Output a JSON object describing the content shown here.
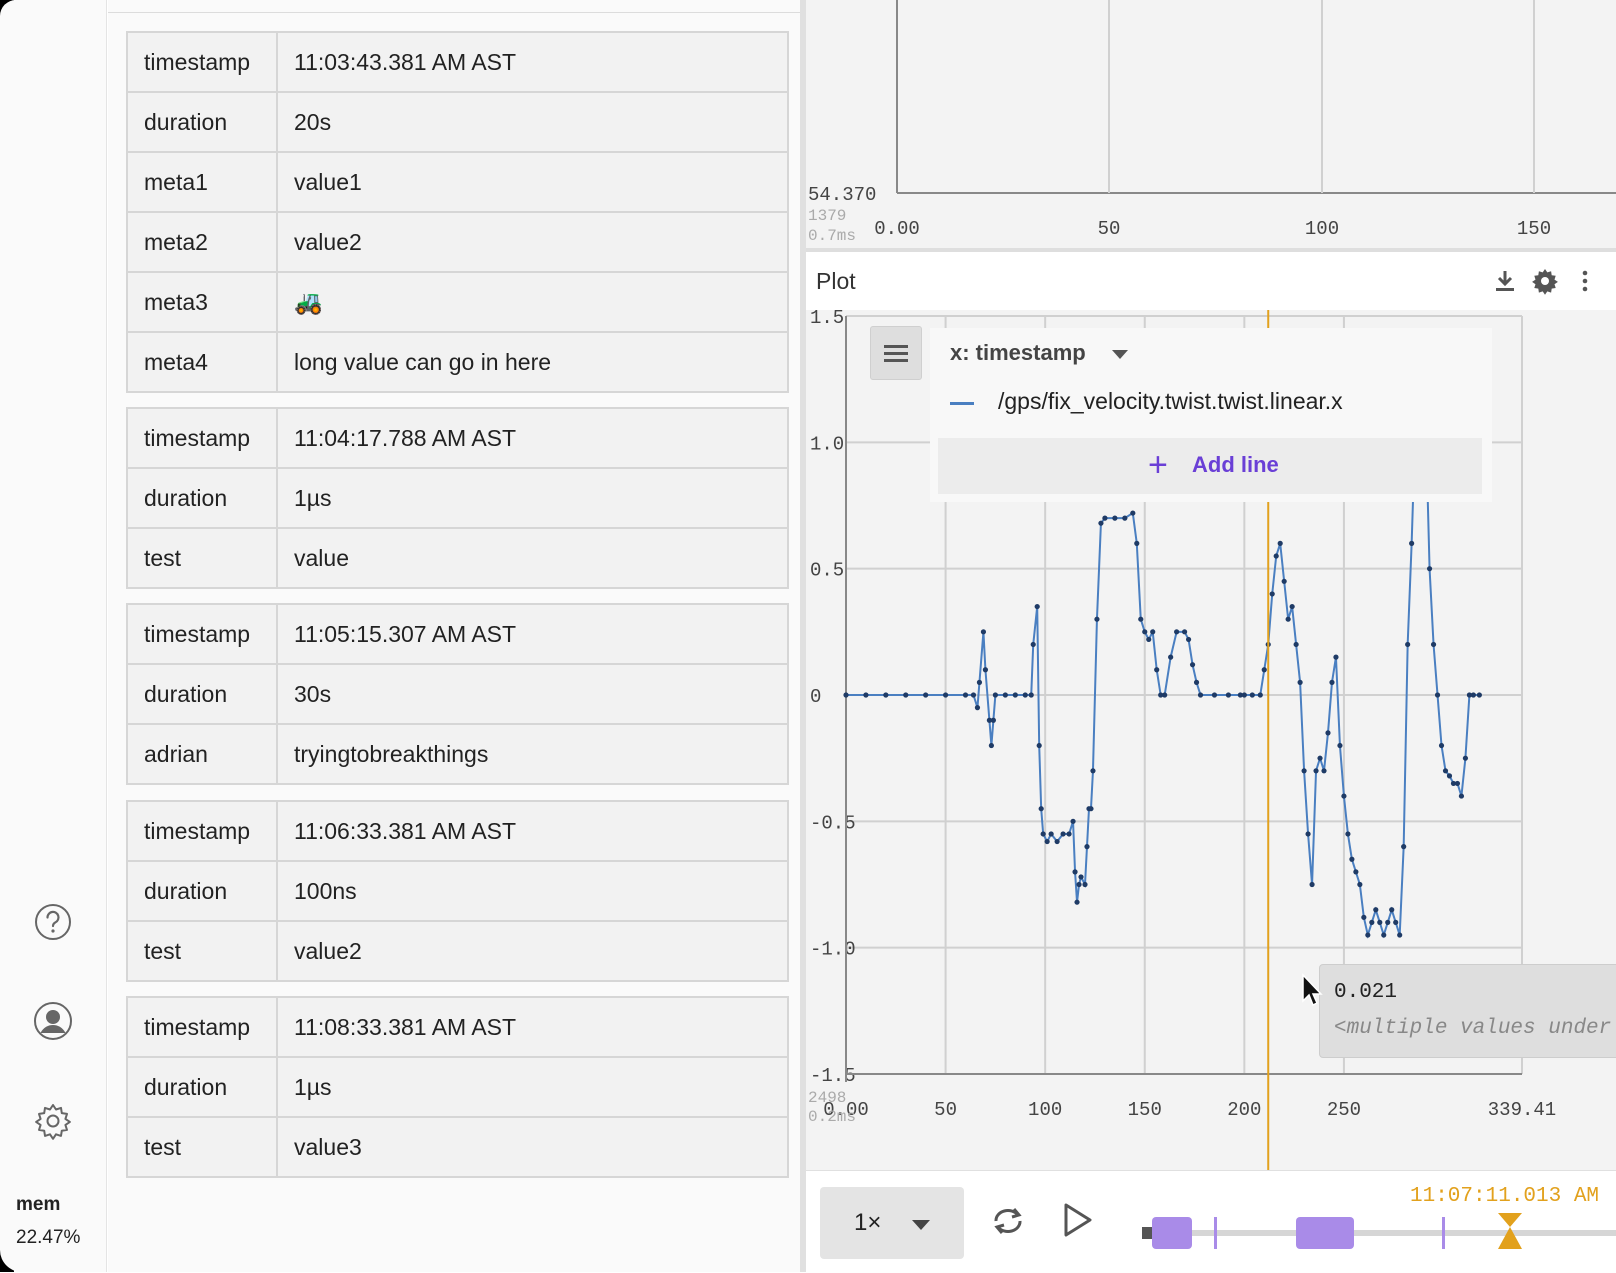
{
  "sidebar": {
    "items": [
      "help-icon",
      "user-icon",
      "gear-icon"
    ],
    "mem_label": "mem",
    "mem_value": "22.47%"
  },
  "metadata": [
    {
      "rows": [
        {
          "key": "timestamp",
          "value": "11:03:43.381 AM AST"
        },
        {
          "key": "duration",
          "value": "20s"
        },
        {
          "key": "meta1",
          "value": "value1"
        },
        {
          "key": "meta2",
          "value": "value2"
        },
        {
          "key": "meta3",
          "value": "🚜"
        },
        {
          "key": "meta4",
          "value": "long value can go in here"
        }
      ]
    },
    {
      "rows": [
        {
          "key": "timestamp",
          "value": "11:04:17.788 AM AST"
        },
        {
          "key": "duration",
          "value": "1µs"
        },
        {
          "key": "test",
          "value": "value"
        }
      ]
    },
    {
      "rows": [
        {
          "key": "timestamp",
          "value": "11:05:15.307 AM AST"
        },
        {
          "key": "duration",
          "value": "30s"
        },
        {
          "key": "adrian",
          "value": "tryingtobreakthings"
        }
      ]
    },
    {
      "rows": [
        {
          "key": "timestamp",
          "value": "11:06:33.381 AM AST"
        },
        {
          "key": "duration",
          "value": "100ns"
        },
        {
          "key": "test",
          "value": "value2"
        }
      ]
    },
    {
      "rows": [
        {
          "key": "timestamp",
          "value": "11:08:33.381 AM AST"
        },
        {
          "key": "duration",
          "value": "1µs"
        },
        {
          "key": "test",
          "value": "value3"
        }
      ]
    }
  ],
  "top_plot": {
    "y_label": "54.370",
    "stats_count": "1379",
    "stats_time": "0.7ms",
    "x_ticks": [
      "0.00",
      "50",
      "100",
      "150"
    ]
  },
  "plot_panel": {
    "title": "Plot",
    "header_icons": [
      "download-icon",
      "gear-icon",
      "more-vertical-icon"
    ],
    "x_selector": "x: timestamp",
    "series_path": "/gps/fix_velocity.twist.twist.linear.x",
    "add_line_label": "Add line",
    "stats_count": "2498",
    "stats_time": "0.2ms",
    "tooltip_value": "0.021",
    "tooltip_note": "<multiple values under cursor>"
  },
  "playback": {
    "speed": "1×",
    "time": "11:07:11.013 AM"
  },
  "colors": {
    "series": "#4a7fc1",
    "series_dark": "#1f3b66",
    "cursor": "#e2a11d",
    "accent": "#6a3fd6",
    "range": "#a98be8"
  },
  "chart_data": {
    "type": "line",
    "xlabel": "",
    "ylabel": "",
    "xlim": [
      0,
      339.41
    ],
    "ylim": [
      -1.5,
      1.5
    ],
    "x_tick_labels": [
      "0.00",
      "50",
      "100",
      "150",
      "200",
      "250",
      "339.41"
    ],
    "y_tick_labels": [
      "1.5",
      "1.0",
      "0.5",
      "0",
      "-0.5",
      "-1.0",
      "-1.5"
    ],
    "cursor_x": 212,
    "series": [
      {
        "name": "/gps/fix_velocity.twist.twist.linear.x",
        "points": [
          [
            0,
            0
          ],
          [
            10,
            0
          ],
          [
            20,
            0
          ],
          [
            30,
            0
          ],
          [
            40,
            0
          ],
          [
            50,
            0
          ],
          [
            60,
            0
          ],
          [
            64,
            0
          ],
          [
            66,
            -0.05
          ],
          [
            67,
            0.05
          ],
          [
            69,
            0.25
          ],
          [
            70,
            0.1
          ],
          [
            72,
            -0.1
          ],
          [
            73,
            -0.2
          ],
          [
            74,
            -0.1
          ],
          [
            75,
            0
          ],
          [
            80,
            0
          ],
          [
            85,
            0
          ],
          [
            90,
            0
          ],
          [
            93,
            0
          ],
          [
            94,
            0.2
          ],
          [
            96,
            0.35
          ],
          [
            97,
            -0.2
          ],
          [
            98,
            -0.45
          ],
          [
            99,
            -0.55
          ],
          [
            101,
            -0.58
          ],
          [
            103,
            -0.55
          ],
          [
            106,
            -0.58
          ],
          [
            109,
            -0.55
          ],
          [
            112,
            -0.55
          ],
          [
            114,
            -0.5
          ],
          [
            115,
            -0.7
          ],
          [
            116,
            -0.82
          ],
          [
            117,
            -0.75
          ],
          [
            118,
            -0.72
          ],
          [
            120,
            -0.75
          ],
          [
            121,
            -0.6
          ],
          [
            122,
            -0.45
          ],
          [
            123,
            -0.45
          ],
          [
            124,
            -0.3
          ],
          [
            126,
            0.3
          ],
          [
            128,
            0.68
          ],
          [
            130,
            0.7
          ],
          [
            135,
            0.7
          ],
          [
            140,
            0.7
          ],
          [
            144,
            0.72
          ],
          [
            146,
            0.6
          ],
          [
            148,
            0.3
          ],
          [
            150,
            0.25
          ],
          [
            152,
            0.22
          ],
          [
            154,
            0.25
          ],
          [
            156,
            0.1
          ],
          [
            158,
            0
          ],
          [
            160,
            0
          ],
          [
            163,
            0.15
          ],
          [
            166,
            0.25
          ],
          [
            170,
            0.25
          ],
          [
            172,
            0.22
          ],
          [
            174,
            0.12
          ],
          [
            176,
            0.05
          ],
          [
            178,
            0
          ],
          [
            185,
            0
          ],
          [
            192,
            0
          ],
          [
            198,
            0
          ],
          [
            200,
            0
          ],
          [
            204,
            0
          ],
          [
            208,
            0
          ],
          [
            210,
            0.1
          ],
          [
            212,
            0.2
          ],
          [
            214,
            0.4
          ],
          [
            216,
            0.55
          ],
          [
            218,
            0.6
          ],
          [
            220,
            0.45
          ],
          [
            222,
            0.3
          ],
          [
            224,
            0.35
          ],
          [
            226,
            0.2
          ],
          [
            228,
            0.05
          ],
          [
            230,
            -0.3
          ],
          [
            232,
            -0.55
          ],
          [
            234,
            -0.75
          ],
          [
            236,
            -0.3
          ],
          [
            238,
            -0.25
          ],
          [
            240,
            -0.3
          ],
          [
            242,
            -0.15
          ],
          [
            244,
            0.05
          ],
          [
            246,
            0.15
          ],
          [
            248,
            -0.2
          ],
          [
            250,
            -0.4
          ],
          [
            252,
            -0.55
          ],
          [
            254,
            -0.65
          ],
          [
            256,
            -0.7
          ],
          [
            258,
            -0.75
          ],
          [
            260,
            -0.88
          ],
          [
            262,
            -0.95
          ],
          [
            264,
            -0.9
          ],
          [
            266,
            -0.85
          ],
          [
            268,
            -0.9
          ],
          [
            270,
            -0.95
          ],
          [
            272,
            -0.9
          ],
          [
            274,
            -0.85
          ],
          [
            276,
            -0.9
          ],
          [
            278,
            -0.95
          ],
          [
            280,
            -0.6
          ],
          [
            282,
            0.2
          ],
          [
            284,
            0.6
          ],
          [
            286,
            1.1
          ],
          [
            288,
            1.15
          ],
          [
            290,
            1.15
          ],
          [
            291,
            1.1
          ],
          [
            293,
            0.5
          ],
          [
            295,
            0.2
          ],
          [
            297,
            0
          ],
          [
            299,
            -0.2
          ],
          [
            301,
            -0.3
          ],
          [
            303,
            -0.32
          ],
          [
            305,
            -0.35
          ],
          [
            307,
            -0.35
          ],
          [
            309,
            -0.4
          ],
          [
            311,
            -0.25
          ],
          [
            313,
            0
          ],
          [
            315,
            0
          ],
          [
            318,
            0
          ]
        ]
      }
    ]
  }
}
